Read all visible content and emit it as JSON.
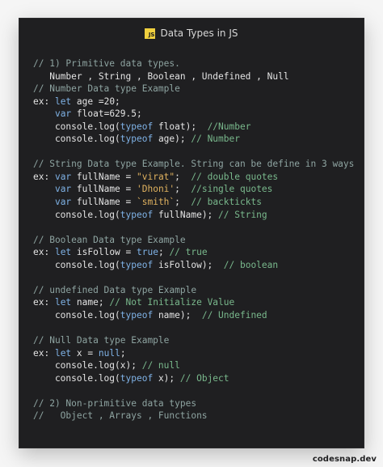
{
  "window": {
    "title": "Data Types in JS",
    "icon": "javascript-icon",
    "icon_text": "JS",
    "bg": "#1f1f21"
  },
  "code_lines": [
    [
      {
        "t": "// 1) Primitive data types.",
        "c": "comment"
      }
    ],
    [
      {
        "t": "   Number , String , Boolean , Undefined , Null",
        "c": "plain"
      }
    ],
    [
      {
        "t": "// Number Data type Example",
        "c": "comment"
      }
    ],
    [
      {
        "t": "ex: ",
        "c": "plain"
      },
      {
        "t": "let",
        "c": "kw"
      },
      {
        "t": " age =20;",
        "c": "plain"
      }
    ],
    [
      {
        "t": "    ",
        "c": "plain"
      },
      {
        "t": "var",
        "c": "kw"
      },
      {
        "t": " float=629.5;",
        "c": "plain"
      }
    ],
    [
      {
        "t": "    console.log(",
        "c": "plain"
      },
      {
        "t": "typeof",
        "c": "kw"
      },
      {
        "t": " float);  ",
        "c": "plain"
      },
      {
        "t": "//Number",
        "c": "commentg"
      }
    ],
    [
      {
        "t": "    console.log(",
        "c": "plain"
      },
      {
        "t": "typeof",
        "c": "kw"
      },
      {
        "t": " age); ",
        "c": "plain"
      },
      {
        "t": "// Number",
        "c": "commentg"
      }
    ],
    [
      {
        "t": "",
        "c": "plain"
      }
    ],
    [
      {
        "t": "// String Data type Example. String can be define in 3 ways",
        "c": "comment"
      }
    ],
    [
      {
        "t": "ex: ",
        "c": "plain"
      },
      {
        "t": "var",
        "c": "kw"
      },
      {
        "t": " fullName = ",
        "c": "plain"
      },
      {
        "t": "\"virat\"",
        "c": "string"
      },
      {
        "t": ";  ",
        "c": "plain"
      },
      {
        "t": "// double quotes",
        "c": "commentg"
      }
    ],
    [
      {
        "t": "    ",
        "c": "plain"
      },
      {
        "t": "var",
        "c": "kw"
      },
      {
        "t": " fullName = ",
        "c": "plain"
      },
      {
        "t": "'Dhoni'",
        "c": "string"
      },
      {
        "t": ";  ",
        "c": "plain"
      },
      {
        "t": "//single quotes",
        "c": "commentg"
      }
    ],
    [
      {
        "t": "    ",
        "c": "plain"
      },
      {
        "t": "var",
        "c": "kw"
      },
      {
        "t": " fullName = ",
        "c": "plain"
      },
      {
        "t": "`smith`",
        "c": "string"
      },
      {
        "t": ";  ",
        "c": "plain"
      },
      {
        "t": "// backtickts",
        "c": "commentg"
      }
    ],
    [
      {
        "t": "    console.log(",
        "c": "plain"
      },
      {
        "t": "typeof",
        "c": "kw"
      },
      {
        "t": " fullName); ",
        "c": "plain"
      },
      {
        "t": "// String",
        "c": "commentg"
      }
    ],
    [
      {
        "t": "",
        "c": "plain"
      }
    ],
    [
      {
        "t": "// Boolean Data type Example",
        "c": "comment"
      }
    ],
    [
      {
        "t": "ex: ",
        "c": "plain"
      },
      {
        "t": "let",
        "c": "kw"
      },
      {
        "t": " isFollow = ",
        "c": "plain"
      },
      {
        "t": "true",
        "c": "kw"
      },
      {
        "t": "; ",
        "c": "plain"
      },
      {
        "t": "// true",
        "c": "commentg"
      }
    ],
    [
      {
        "t": "    console.log(",
        "c": "plain"
      },
      {
        "t": "typeof",
        "c": "kw"
      },
      {
        "t": " isFollow);  ",
        "c": "plain"
      },
      {
        "t": "// boolean",
        "c": "commentg"
      }
    ],
    [
      {
        "t": "",
        "c": "plain"
      }
    ],
    [
      {
        "t": "// undefined Data type Example",
        "c": "comment"
      }
    ],
    [
      {
        "t": "ex: ",
        "c": "plain"
      },
      {
        "t": "let",
        "c": "kw"
      },
      {
        "t": " name; ",
        "c": "plain"
      },
      {
        "t": "// Not Initialize Value",
        "c": "commentg"
      }
    ],
    [
      {
        "t": "    console.log(",
        "c": "plain"
      },
      {
        "t": "typeof",
        "c": "kw"
      },
      {
        "t": " name);  ",
        "c": "plain"
      },
      {
        "t": "// Undefined",
        "c": "commentg"
      }
    ],
    [
      {
        "t": "",
        "c": "plain"
      }
    ],
    [
      {
        "t": "// Null Data type Example",
        "c": "comment"
      }
    ],
    [
      {
        "t": "ex: ",
        "c": "plain"
      },
      {
        "t": "let",
        "c": "kw"
      },
      {
        "t": " x = ",
        "c": "plain"
      },
      {
        "t": "null",
        "c": "kw"
      },
      {
        "t": ";",
        "c": "plain"
      }
    ],
    [
      {
        "t": "    console.log(x); ",
        "c": "plain"
      },
      {
        "t": "// null",
        "c": "commentg"
      }
    ],
    [
      {
        "t": "    console.log(",
        "c": "plain"
      },
      {
        "t": "typeof",
        "c": "kw"
      },
      {
        "t": " x); ",
        "c": "plain"
      },
      {
        "t": "// Object",
        "c": "commentg"
      }
    ],
    [
      {
        "t": "",
        "c": "plain"
      }
    ],
    [
      {
        "t": "// 2) Non-primitive data types",
        "c": "comment"
      }
    ],
    [
      {
        "t": "//   Object , Arrays , Functions",
        "c": "comment"
      }
    ]
  ],
  "footer": {
    "watermark": "codesnap.dev"
  },
  "colors": {
    "comment": "#8ea4a1",
    "comment_green": "#79b88c",
    "keyword": "#7fb2e6",
    "string": "#e0b25f",
    "text": "#e4e4e4"
  }
}
